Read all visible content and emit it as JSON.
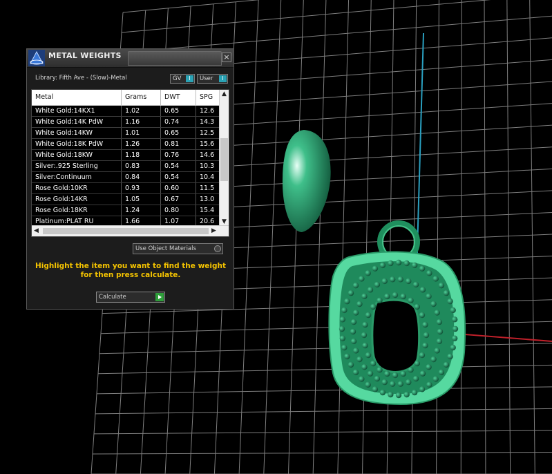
{
  "panel": {
    "title": "METAL WEIGHTS",
    "close_label": "×",
    "library_label": "Library: Fifth Ave - (Slow)-Metal",
    "gv_label": "GV",
    "user_label": "User",
    "toggle_knob": "I",
    "columns": [
      "Metal",
      "Grams",
      "DWT",
      "SPG"
    ],
    "rows": [
      [
        "White Gold:14KX1",
        "1.02",
        "0.65",
        "12.6"
      ],
      [
        "White Gold:14K PdW",
        "1.16",
        "0.74",
        "14.3"
      ],
      [
        "White Gold:14KW",
        "1.01",
        "0.65",
        "12.5"
      ],
      [
        "White Gold:18K PdW",
        "1.26",
        "0.81",
        "15.6"
      ],
      [
        "White Gold:18KW",
        "1.18",
        "0.76",
        "14.6"
      ],
      [
        "Silver:.925 Sterling",
        "0.83",
        "0.54",
        "10.3"
      ],
      [
        "Silver:Continuum",
        "0.84",
        "0.54",
        "10.4"
      ],
      [
        "Rose Gold:10KR",
        "0.93",
        "0.60",
        "11.5"
      ],
      [
        "Rose Gold:14KR",
        "1.05",
        "0.67",
        "13.0"
      ],
      [
        "Rose Gold:18KR",
        "1.24",
        "0.80",
        "15.4"
      ],
      [
        "Platinum:PLAT RU",
        "1.66",
        "1.07",
        "20.6"
      ]
    ],
    "use_object_materials": "Use Object Materials",
    "hint": "Highlight the item you want to find the weight for then press calculate.",
    "calculate_label": "Calculate"
  },
  "viewport": {
    "grid_color": "#7f7f7f",
    "axis_y_color": "#2aa0c0",
    "axis_x_color": "#c0202a",
    "model_color": "#1f8f5e"
  }
}
